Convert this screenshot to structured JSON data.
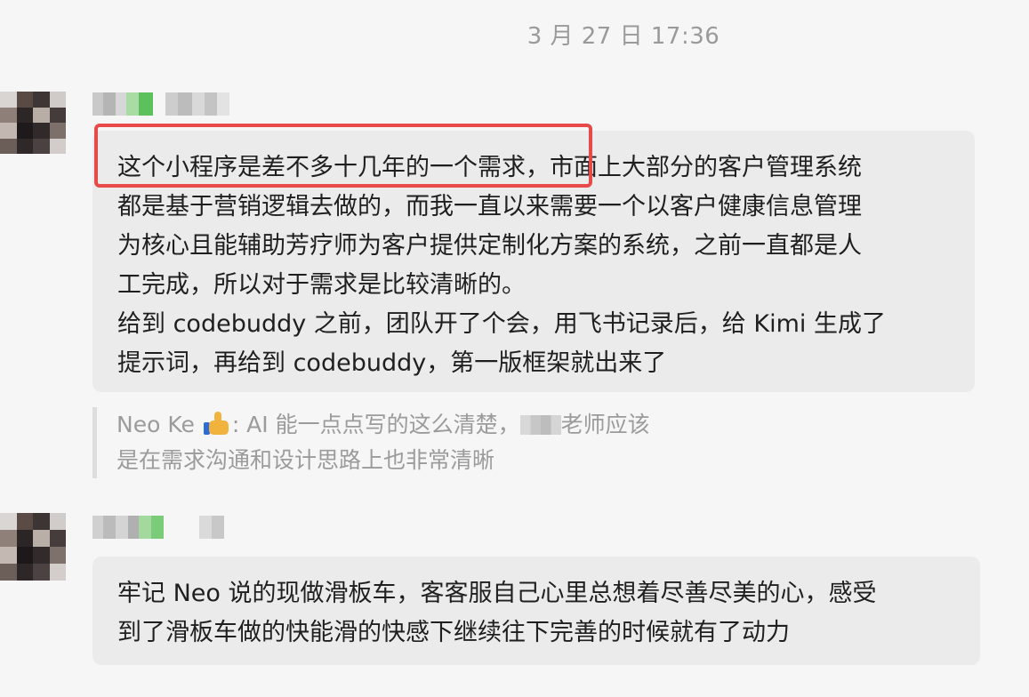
{
  "chat": {
    "timestamp": "3 月 27 日 17:36",
    "messages": [
      {
        "lines": [
          "这个小程序是差不多十几年的一个需求，市面上大部分的客户管理系统",
          "都是基于营销逻辑去做的，而我一直以来需要一个以客户健康信息管理",
          "为核心且能辅助芳疗师为客户提供定制化方案的系统，之前一直都是人",
          "工完成，所以对于需求是比较清晰的。",
          "给到 codebuddy 之前，团队开了个会，用飞书记录后，给 Kimi 生成了",
          "提示词，再给到 codebuddy，第一版框架就出来了"
        ]
      },
      {
        "lines": [
          "牢记 Neo 说的现做滑板车，客客服自己心里总想着尽善尽美的心，感受",
          "到了滑板车做的快能滑的快感下继续往下完善的时候就有了动力"
        ]
      }
    ],
    "quote": {
      "author": "Neo Ke",
      "icon": "thumbs-up-icon",
      "text_before": ": AI 能一点点写的这么清楚，",
      "text_after": "老师应该",
      "line2": "是在需求沟通和设计思路上也非常清晰"
    },
    "colors": {
      "background": "#f6f6f6",
      "bubble": "#ebebeb",
      "highlight": "#e84a4a",
      "muted_text": "#9b9b9b"
    }
  }
}
